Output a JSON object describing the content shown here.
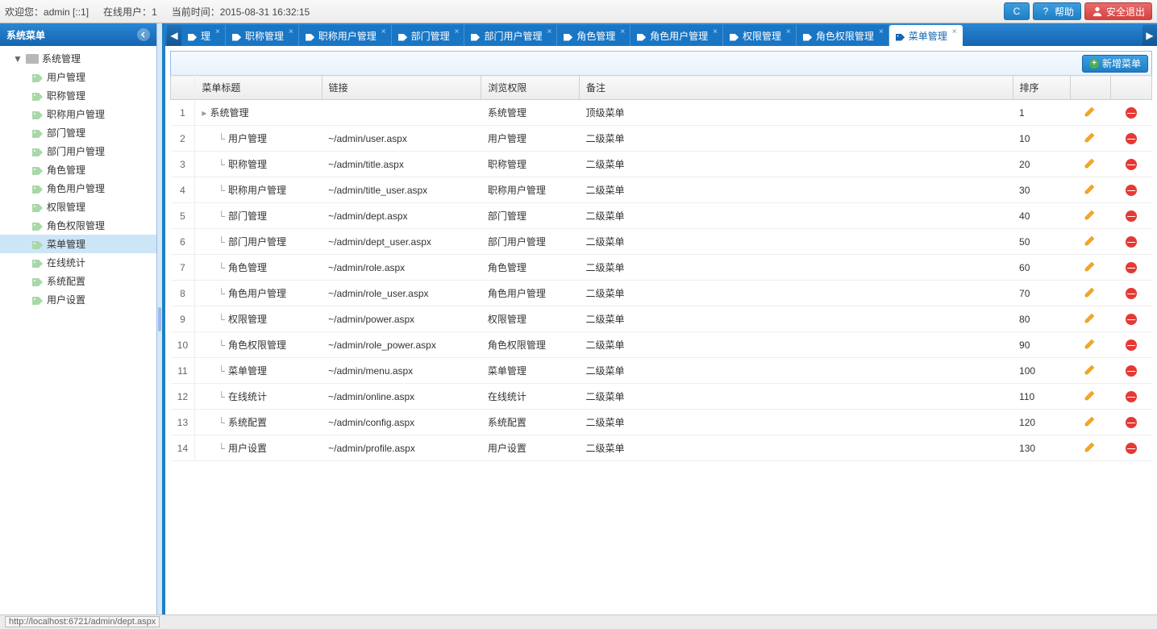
{
  "topbar": {
    "welcome_label": "欢迎您：",
    "welcome_user": "admin [::1]",
    "online_label": "在线用户：",
    "online_count": "1",
    "time_label": "当前时间：",
    "time_value": "2015-08-31 16:32:15",
    "refresh_label": "C",
    "help_label": "帮助",
    "logout_label": "安全退出"
  },
  "sidebar": {
    "title": "系统菜单",
    "root": "系统管理",
    "items": [
      {
        "label": "用户管理"
      },
      {
        "label": "职称管理"
      },
      {
        "label": "职称用户管理"
      },
      {
        "label": "部门管理"
      },
      {
        "label": "部门用户管理"
      },
      {
        "label": "角色管理"
      },
      {
        "label": "角色用户管理"
      },
      {
        "label": "权限管理"
      },
      {
        "label": "角色权限管理"
      },
      {
        "label": "菜单管理",
        "selected": true
      },
      {
        "label": "在线统计"
      },
      {
        "label": "系统配置"
      },
      {
        "label": "用户设置"
      }
    ]
  },
  "tabs": [
    {
      "label": "理"
    },
    {
      "label": "职称管理"
    },
    {
      "label": "职称用户管理"
    },
    {
      "label": "部门管理"
    },
    {
      "label": "部门用户管理"
    },
    {
      "label": "角色管理"
    },
    {
      "label": "角色用户管理"
    },
    {
      "label": "权限管理"
    },
    {
      "label": "角色权限管理"
    },
    {
      "label": "菜单管理",
      "active": true
    }
  ],
  "toolbar": {
    "add_label": "新增菜单"
  },
  "grid": {
    "columns": [
      "菜单标题",
      "链接",
      "浏览权限",
      "备注",
      "排序"
    ],
    "rows": [
      {
        "n": "1",
        "title": "系统管理",
        "link": "",
        "perm": "系统管理",
        "remark": "顶级菜单",
        "sort": "1",
        "indent": false
      },
      {
        "n": "2",
        "title": "用户管理",
        "link": "~/admin/user.aspx",
        "perm": "用户管理",
        "remark": "二级菜单",
        "sort": "10",
        "indent": true
      },
      {
        "n": "3",
        "title": "职称管理",
        "link": "~/admin/title.aspx",
        "perm": "职称管理",
        "remark": "二级菜单",
        "sort": "20",
        "indent": true
      },
      {
        "n": "4",
        "title": "职称用户管理",
        "link": "~/admin/title_user.aspx",
        "perm": "职称用户管理",
        "remark": "二级菜单",
        "sort": "30",
        "indent": true
      },
      {
        "n": "5",
        "title": "部门管理",
        "link": "~/admin/dept.aspx",
        "perm": "部门管理",
        "remark": "二级菜单",
        "sort": "40",
        "indent": true
      },
      {
        "n": "6",
        "title": "部门用户管理",
        "link": "~/admin/dept_user.aspx",
        "perm": "部门用户管理",
        "remark": "二级菜单",
        "sort": "50",
        "indent": true
      },
      {
        "n": "7",
        "title": "角色管理",
        "link": "~/admin/role.aspx",
        "perm": "角色管理",
        "remark": "二级菜单",
        "sort": "60",
        "indent": true
      },
      {
        "n": "8",
        "title": "角色用户管理",
        "link": "~/admin/role_user.aspx",
        "perm": "角色用户管理",
        "remark": "二级菜单",
        "sort": "70",
        "indent": true
      },
      {
        "n": "9",
        "title": "权限管理",
        "link": "~/admin/power.aspx",
        "perm": "权限管理",
        "remark": "二级菜单",
        "sort": "80",
        "indent": true
      },
      {
        "n": "10",
        "title": "角色权限管理",
        "link": "~/admin/role_power.aspx",
        "perm": "角色权限管理",
        "remark": "二级菜单",
        "sort": "90",
        "indent": true
      },
      {
        "n": "11",
        "title": "菜单管理",
        "link": "~/admin/menu.aspx",
        "perm": "菜单管理",
        "remark": "二级菜单",
        "sort": "100",
        "indent": true
      },
      {
        "n": "12",
        "title": "在线统计",
        "link": "~/admin/online.aspx",
        "perm": "在线统计",
        "remark": "二级菜单",
        "sort": "110",
        "indent": true
      },
      {
        "n": "13",
        "title": "系统配置",
        "link": "~/admin/config.aspx",
        "perm": "系统配置",
        "remark": "二级菜单",
        "sort": "120",
        "indent": true
      },
      {
        "n": "14",
        "title": "用户设置",
        "link": "~/admin/profile.aspx",
        "perm": "用户设置",
        "remark": "二级菜单",
        "sort": "130",
        "indent": true
      }
    ]
  },
  "statusbar": {
    "text": "http://localhost:6721/admin/dept.aspx"
  }
}
